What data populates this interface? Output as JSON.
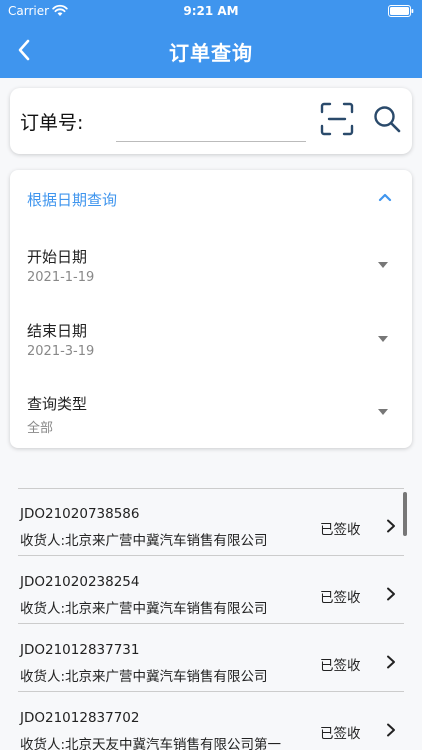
{
  "status_bar": {
    "carrier": "Carrier",
    "time": "9:21 AM",
    "wifi_icon": "wifi-icon",
    "battery_icon": "battery-icon"
  },
  "nav": {
    "title": "订单查询",
    "back_icon": "chevron-left-icon"
  },
  "search": {
    "label": "订单号:",
    "value": "",
    "placeholder": "",
    "scan_icon": "scan-icon",
    "search_icon": "search-icon"
  },
  "date_query": {
    "title": "根据日期查询",
    "expanded": true,
    "fields": [
      {
        "label": "开始日期",
        "value": "2021-1-19"
      },
      {
        "label": "结束日期",
        "value": "2021-3-19"
      },
      {
        "label": "查询类型",
        "value": "全部"
      }
    ]
  },
  "orders": [
    {
      "order_no": "JDO21020738586",
      "consignee": "收货人:北京来广营中冀汽车销售有限公司",
      "status": "已签收"
    },
    {
      "order_no": "JDO21020238254",
      "consignee": "收货人:北京来广营中冀汽车销售有限公司",
      "status": "已签收"
    },
    {
      "order_no": "JDO21012837731",
      "consignee": "收货人:北京来广营中冀汽车销售有限公司",
      "status": "已签收"
    },
    {
      "order_no": "JDO21012837702",
      "consignee": "收货人:北京天友中冀汽车销售有限公司第一",
      "status": "已签收"
    }
  ],
  "colors": {
    "primary": "#3f95ee",
    "scan_icon": "#2a4a6b",
    "background": "#f7f8fa"
  }
}
